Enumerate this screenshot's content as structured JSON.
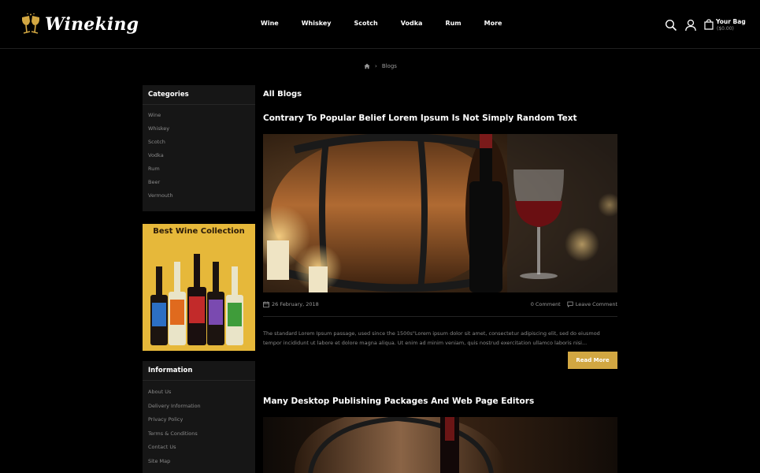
{
  "brand": {
    "name": "Wineking"
  },
  "nav": {
    "items": [
      "Wine",
      "Whiskey",
      "Scotch",
      "Vodka",
      "Rum",
      "More"
    ]
  },
  "header": {
    "icons": [
      "search-icon",
      "user-icon",
      "bag-icon"
    ],
    "bag_title": "Your Bag",
    "bag_total": "($0.00)"
  },
  "breadcrumb": {
    "separator": "›",
    "current": "Blogs"
  },
  "sidebar": {
    "categories_title": "Categories",
    "categories": [
      "Wine",
      "Whiskey",
      "Scotch",
      "Vodka",
      "Rum",
      "Beer",
      "Vermouth"
    ],
    "promo_title": "Best Wine Collection",
    "information_title": "Information",
    "information": [
      "About Us",
      "Delivery Information",
      "Privacy Policy",
      "Terms & Conditions",
      "Contact Us",
      "Site Map"
    ]
  },
  "main": {
    "title": "All Blogs",
    "posts": [
      {
        "title": "Contrary To Popular Belief Lorem Ipsum Is Not Simply Random Text",
        "date": "26 February, 2018",
        "comments": "0 Comment",
        "leave_comment": "Leave Comment",
        "excerpt": "The standard Lorem Ipsum passage, used since the 1500s\"Lorem ipsum dolor sit amet, consectetur adipiscing elit, sed do eiusmod tempor incididunt ut labore et dolore magna aliqua. Ut enim ad minim veniam, quis nostrud exercitation ullamco laboris nisi...",
        "read_more": "Read More"
      },
      {
        "title": "Many Desktop Publishing Packages And Web Page Editors"
      }
    ]
  },
  "colors": {
    "background": "#000000",
    "panel": "#161616",
    "accent": "#d2a742",
    "promo": "#e6b83a",
    "muted_text": "#8a8a8a"
  }
}
